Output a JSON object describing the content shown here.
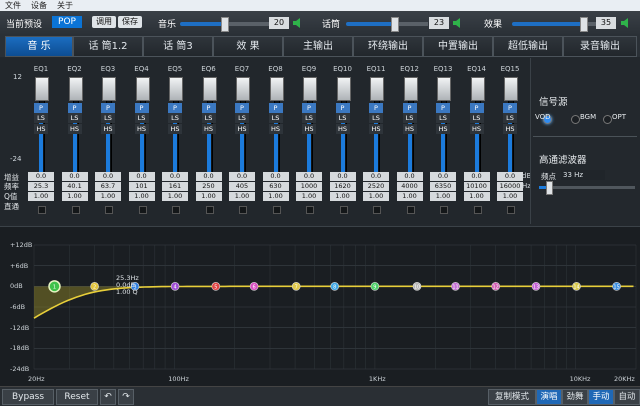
{
  "menu": [
    "文件",
    "设备",
    "关于"
  ],
  "preset": {
    "label": "当前预设",
    "value": "POP",
    "load": "调用",
    "save": "保存"
  },
  "volumes": [
    {
      "label": "音乐",
      "value": "20",
      "level": 0.48
    },
    {
      "label": "话筒",
      "value": "23",
      "level": 0.55
    },
    {
      "label": "效果",
      "value": "35",
      "level": 0.85
    }
  ],
  "tabs": [
    "音 乐",
    "话 筒1.2",
    "话 筒3",
    "效 果",
    "主输出",
    "环绕输出",
    "中置输出",
    "超低输出",
    "录音输出"
  ],
  "eq": {
    "db_top": "12",
    "db_bottom": "-24",
    "row_labels": [
      "增益",
      "频率",
      "Q值",
      "直通"
    ],
    "switch_labels": [
      "P",
      "LS",
      "HS"
    ],
    "unit_db": "dB",
    "unit_hz": "Hz",
    "bands": [
      {
        "name": "EQ1",
        "gain": "0.0",
        "freq": "25.3",
        "q": "1.00"
      },
      {
        "name": "EQ2",
        "gain": "0.0",
        "freq": "40.1",
        "q": "1.00"
      },
      {
        "name": "EQ3",
        "gain": "0.0",
        "freq": "63.7",
        "q": "1.00"
      },
      {
        "name": "EQ4",
        "gain": "0.0",
        "freq": "101",
        "q": "1.00"
      },
      {
        "name": "EQ5",
        "gain": "0.0",
        "freq": "161",
        "q": "1.00"
      },
      {
        "name": "EQ6",
        "gain": "0.0",
        "freq": "250",
        "q": "1.00"
      },
      {
        "name": "EQ7",
        "gain": "0.0",
        "freq": "405",
        "q": "1.00"
      },
      {
        "name": "EQ8",
        "gain": "0.0",
        "freq": "630",
        "q": "1.00"
      },
      {
        "name": "EQ9",
        "gain": "0.0",
        "freq": "1000",
        "q": "1.00"
      },
      {
        "name": "EQ10",
        "gain": "0.0",
        "freq": "1620",
        "q": "1.00"
      },
      {
        "name": "EQ11",
        "gain": "0.0",
        "freq": "2520",
        "q": "1.00"
      },
      {
        "name": "EQ12",
        "gain": "0.0",
        "freq": "4000",
        "q": "1.00"
      },
      {
        "name": "EQ13",
        "gain": "0.0",
        "freq": "6350",
        "q": "1.00"
      },
      {
        "name": "EQ14",
        "gain": "0.0",
        "freq": "10100",
        "q": "1.00"
      },
      {
        "name": "EQ15",
        "gain": "0.0",
        "freq": "16000",
        "q": "1.00"
      }
    ]
  },
  "signal": {
    "title": "信号源",
    "options": [
      {
        "label": "VOD",
        "on": true
      },
      {
        "label": "BGM",
        "on": false
      },
      {
        "label": "OPT",
        "on": false
      }
    ]
  },
  "highpass": {
    "title": "高通滤波器",
    "label": "频点",
    "value": "33 Hz"
  },
  "graph": {
    "y_labels": [
      "+12dB",
      "+6dB",
      "0dB",
      "-6dB",
      "-12dB",
      "-18dB",
      "-24dB"
    ],
    "x_labels": [
      "20Hz",
      "100Hz",
      "1KHz",
      "10KHz",
      "20KHz"
    ],
    "tooltip": [
      "25.3Hz",
      "0.0dB",
      "1.00 Q"
    ],
    "nodes": [
      {
        "n": "1",
        "color": "#3fc24a"
      },
      {
        "n": "2",
        "color": "#e2c53c"
      },
      {
        "n": "3",
        "color": "#2f7fe0"
      },
      {
        "n": "4",
        "color": "#a04fd6"
      },
      {
        "n": "5",
        "color": "#e24646"
      },
      {
        "n": "6",
        "color": "#d94fc2"
      },
      {
        "n": "7",
        "color": "#e0c94b"
      },
      {
        "n": "8",
        "color": "#3fa8e6"
      },
      {
        "n": "9",
        "color": "#4ed06a"
      },
      {
        "n": "10",
        "color": "#b7b7b7"
      },
      {
        "n": "11",
        "color": "#c46fd6"
      },
      {
        "n": "12",
        "color": "#d35fb4"
      },
      {
        "n": "13",
        "color": "#c55fd6"
      },
      {
        "n": "14",
        "color": "#d7c84a"
      },
      {
        "n": "15",
        "color": "#3b8ee0"
      }
    ]
  },
  "bottom": {
    "bypass": "Bypass",
    "reset": "Reset",
    "modes": [
      "复制模式",
      "演唱",
      "劲舞",
      "手动",
      "自动"
    ]
  }
}
